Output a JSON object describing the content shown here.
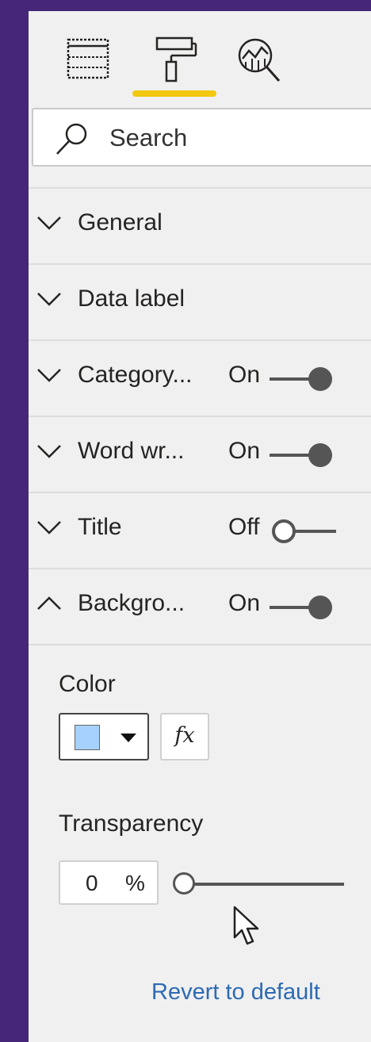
{
  "toolbar": {
    "tabs": [
      {
        "name": "fields",
        "icon": "fields-table-icon"
      },
      {
        "name": "format",
        "icon": "paint-roller-icon",
        "active": true
      },
      {
        "name": "analytics",
        "icon": "analytics-magnifier-icon"
      }
    ],
    "active_color": "#f2c811"
  },
  "search": {
    "placeholder": "Search"
  },
  "sections": [
    {
      "label": "General",
      "expanded": false
    },
    {
      "label": "Data label",
      "expanded": false
    },
    {
      "label": "Category...",
      "state": "On",
      "toggle_on": true,
      "expanded": false
    },
    {
      "label": "Word wr...",
      "state": "On",
      "toggle_on": true,
      "expanded": false
    },
    {
      "label": "Title",
      "state": "Off",
      "toggle_on": false,
      "expanded": false
    },
    {
      "label": "Backgro...",
      "state": "On",
      "toggle_on": true,
      "expanded": true
    }
  ],
  "background": {
    "color_label": "Color",
    "color_value": "#a6d1ff",
    "fx_label": "fx",
    "transparency_label": "Transparency",
    "transparency_value": "0",
    "transparency_unit": "%",
    "transparency_fraction": 0,
    "revert_label": "Revert to default"
  }
}
